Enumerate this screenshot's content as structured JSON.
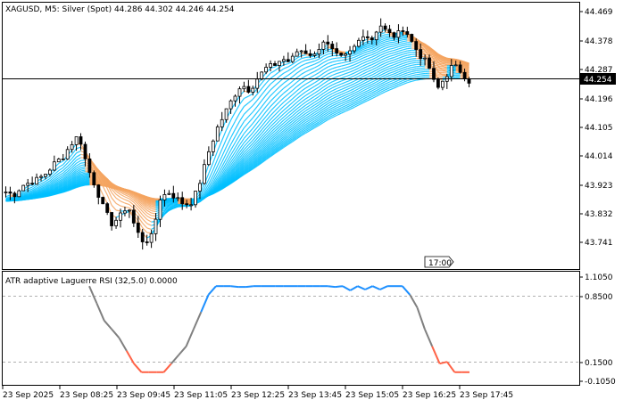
{
  "window": {
    "title": "XAGUSD, M5:  Silver (Spot)  44.286 44.302 44.246 44.254"
  },
  "price_panel": {
    "current_price": "44.254",
    "time_marker": "17:00",
    "price_axis_labels": [
      "44.469",
      "44.378",
      "44.287",
      "44.196",
      "44.105",
      "44.014",
      "43.923",
      "43.832",
      "43.741"
    ]
  },
  "indicator_panel": {
    "title": "ATR adaptive Laguerre RSI (32,5.0) 0.0000",
    "axis_labels": [
      "1.1050",
      "0.8500",
      "0.1500",
      "-0.1050"
    ]
  },
  "time_axis_labels": [
    "23 Sep 2025",
    "23 Sep 08:25",
    "23 Sep 09:45",
    "23 Sep 11:05",
    "23 Sep 12:25",
    "23 Sep 13:45",
    "23 Sep 15:05",
    "23 Sep 16:25",
    "23 Sep 17:45"
  ],
  "colors": {
    "candle": "#000000",
    "ribbon_up": "#00BFFF",
    "ribbon_down": "#F4A460",
    "bid_line": "#000000",
    "rsi_up": "#1E90FF",
    "rsi_mid": "#808080",
    "rsi_down": "#FF6347"
  },
  "chart_data": [
    {
      "type": "candlestick",
      "symbol": "XAGUSD",
      "timeframe": "M5",
      "ylim": [
        43.7,
        44.5
      ],
      "close_path": [
        43.9,
        43.89,
        43.92,
        43.93,
        43.94,
        43.96,
        43.99,
        44.01,
        44.05,
        44.08,
        43.98,
        43.92,
        43.85,
        43.8,
        43.82,
        43.86,
        43.78,
        43.74,
        43.76,
        43.88,
        43.9,
        43.88,
        43.86,
        43.87,
        43.94,
        44.03,
        44.1,
        44.15,
        44.2,
        44.24,
        44.22,
        44.26,
        44.29,
        44.3,
        44.32,
        44.31,
        44.35,
        44.34,
        44.33,
        44.38,
        44.35,
        44.32,
        44.33,
        44.36,
        44.4,
        44.38,
        44.43,
        44.4,
        44.39,
        44.42,
        44.37,
        44.33,
        44.3,
        44.22,
        44.26,
        44.3,
        44.28,
        44.25
      ],
      "ribbon": "fan of adaptive moving averages, blue when rising, orange when falling"
    },
    {
      "type": "line",
      "name": "ATR adaptive Laguerre RSI",
      "ylim": [
        -0.105,
        1.105
      ],
      "levels": [
        0.85,
        0.15
      ],
      "values": [
        1.0,
        0.8,
        0.6,
        0.5,
        0.4,
        0.25,
        0.1,
        0.0,
        0.0,
        0.0,
        0.0,
        0.1,
        0.2,
        0.3,
        0.5,
        0.7,
        0.9,
        1.0,
        1.0,
        1.0,
        0.99,
        0.99,
        1.0,
        1.0,
        1.0,
        1.0,
        1.0,
        1.0,
        1.0,
        1.0,
        1.0,
        1.0,
        1.0,
        0.99,
        1.0,
        0.95,
        1.0,
        0.96,
        1.0,
        0.96,
        1.0,
        1.0,
        1.0,
        0.9,
        0.75,
        0.5,
        0.3,
        0.1,
        0.12,
        0.0,
        0.0,
        0.0
      ]
    }
  ]
}
